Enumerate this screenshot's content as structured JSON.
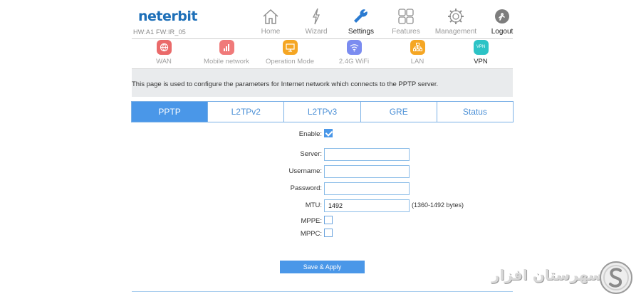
{
  "brand": {
    "logo": "neterbit",
    "firmware": "HW:A1 FW:IR_05"
  },
  "topnav": [
    {
      "key": "home",
      "label": "Home",
      "icon": "home-icon",
      "active": false
    },
    {
      "key": "wizard",
      "label": "Wizard",
      "icon": "wizard-icon",
      "active": false
    },
    {
      "key": "settings",
      "label": "Settings",
      "icon": "wrench-icon",
      "active": true
    },
    {
      "key": "features",
      "label": "Features",
      "icon": "grid-icon",
      "active": false
    },
    {
      "key": "management",
      "label": "Management",
      "icon": "gear-icon",
      "active": false
    },
    {
      "key": "logout",
      "label": "Logout",
      "icon": "logout-icon",
      "active": false
    }
  ],
  "subnav": [
    {
      "label": "WAN",
      "icon": "globe-icon",
      "color": "#ea6a6a",
      "active": false
    },
    {
      "label": "Mobile network",
      "icon": "signal-bars-icon",
      "color": "#f07a7a",
      "active": false
    },
    {
      "label": "Operation Mode",
      "icon": "monitor-icon",
      "color": "#f5a623",
      "active": false
    },
    {
      "label": "2.4G WiFi",
      "icon": "wifi-icon",
      "color": "#7b8cf0",
      "active": false
    },
    {
      "label": "LAN",
      "icon": "lan-icon",
      "color": "#f5a623",
      "active": false
    },
    {
      "label": "VPN",
      "icon": "vpn-icon",
      "color": "#2cc3c6",
      "active": true
    }
  ],
  "vpn_icon_text": "VPN",
  "description": "This page is used to configure the parameters for Internet network which connects to the PPTP server.",
  "tabs": [
    {
      "label": "PPTP",
      "active": true
    },
    {
      "label": "L2TPv2",
      "active": false
    },
    {
      "label": "L2TPv3",
      "active": false
    },
    {
      "label": "GRE",
      "active": false
    },
    {
      "label": "Status",
      "active": false
    }
  ],
  "form": {
    "enable_label": "Enable:",
    "enable_checked": true,
    "server_label": "Server:",
    "server_value": "",
    "username_label": "Username:",
    "username_value": "",
    "password_label": "Password:",
    "password_value": "",
    "mtu_label": "MTU:",
    "mtu_value": "1492",
    "mtu_hint": "(1360-1492 bytes)",
    "mppe_label": "MPPE:",
    "mppe_checked": false,
    "mppc_label": "MPPC:",
    "mppc_checked": false
  },
  "apply_label": "Save & Apply",
  "watermark": {
    "text": "سهرستان افزار",
    "logo": "s-logo-icon"
  },
  "colors": {
    "accent": "#4a97e8",
    "brand": "#1d6fb8"
  }
}
